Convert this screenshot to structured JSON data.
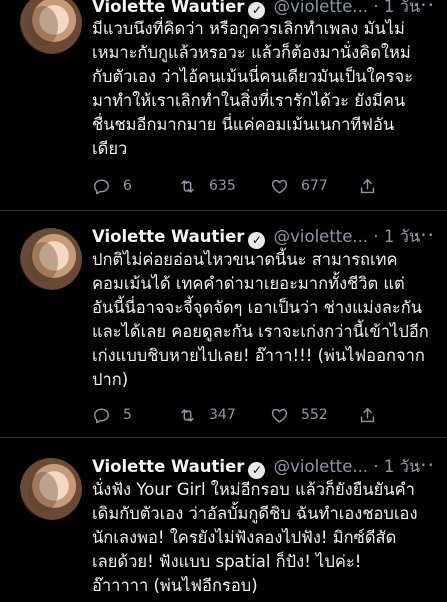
{
  "tweets": [
    {
      "name": "Violette Wautier",
      "handle": "@violette...",
      "sep": "·",
      "time": "1 วัน",
      "text": "มีแวบนึงที่คิดว่า หรือกูควรเลิกทำเพลง มันไม่\nเหมาะกับกูแล้วหรอวะ แล้วก็ต้องมานั่งคิดใหม่\nกับตัวเอง ว่าไอ้คนเม้นนี่คนเดียวมันเป็นใครจะ\nมาทำให้เราเลิกทำในสิ่งที่เรารักได้วะ ยังมีคน\nชื่นชมอีกมากมาย นี่แค่คอมเม้นเนกาทีฟอัน\nเดียว",
      "replies": "6",
      "retweets": "635",
      "likes": "677"
    },
    {
      "name": "Violette Wautier",
      "handle": "@violette...",
      "sep": "·",
      "time": "1 วัน",
      "text": "ปกติไม่ค่อยอ่อนไหวขนาดนี้นะ สามารถเทค\nคอมเม้นได้ เทคคำด่ามาเยอะมากทั้งชีวิต แต่\nอันนี้นี่อาจจะจี้จุดจัดๆ เอาเป็นว่า ช่างแม่งละกัน\nและได้เลย คอยดูละกัน เราจะเก่งกว่านี้เข้าไปอีก\nเก่งแบบชิบหายไปเลย! อ๊าาา!!! (พ่นไฟออกจาก\nปาก)",
      "replies": "5",
      "retweets": "347",
      "likes": "552"
    },
    {
      "name": "Violette Wautier",
      "handle": "@violette...",
      "sep": "·",
      "time": "1 วัน",
      "text": "นั่งฟัง Your Girl ใหม่อีกรอบ แล้วก็ยังยืนยันคำ\nเดิมกับตัวเอง ว่าอัลบั้มกูดีชิบ ฉันทำเองชอบเอง\nนักเลงพอ! ใครยังไม่ฟังลองไปฟัง! มิกซ์ดีสัด\nเลยด้วย! ฟังแบบ spatial ก็ปัง! ไปค่ะ!\nอ๊าาาาา (พ่นไฟอีกรอบ)"
    }
  ],
  "more_glyph": "···",
  "verified_glyph": "✓",
  "colors": {
    "background": "#000000",
    "text": "#e7e9ea",
    "muted": "#8b98a5",
    "divider": "#2f3336"
  },
  "icons": [
    "reply-icon",
    "retweet-icon",
    "like-icon",
    "share-icon",
    "verified-icon",
    "more-icon"
  ]
}
